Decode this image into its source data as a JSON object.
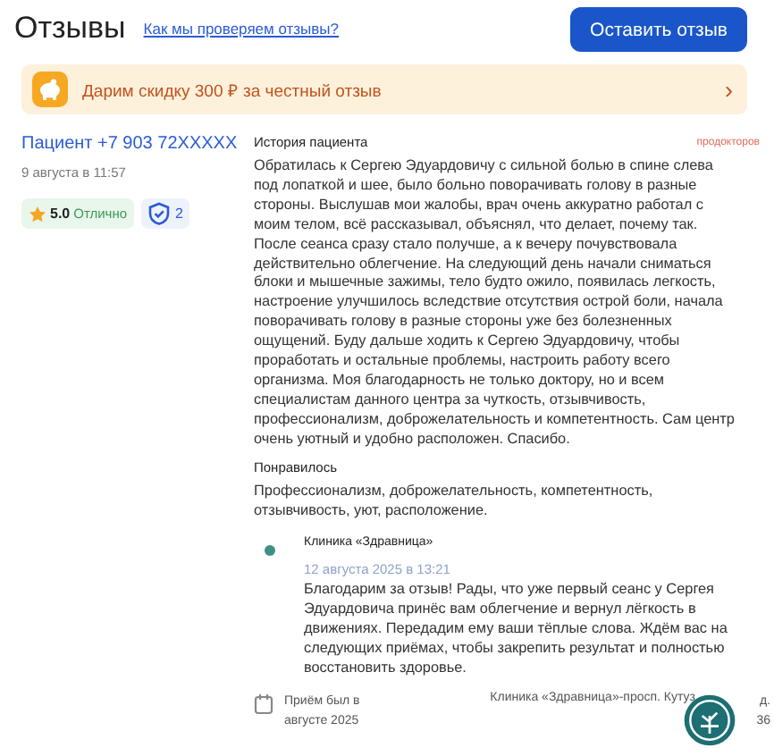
{
  "header": {
    "title": "Отзывы",
    "link": "Как мы проверяем отзывы?",
    "button": "Оставить отзыв"
  },
  "promo": {
    "text": "Дарим скидку 300 ₽ за честный отзыв",
    "arrow": "›"
  },
  "review": {
    "author": "Пациент +7 903 72XXXXX",
    "date": "9 августа в 11:57",
    "rating": "5.0",
    "rating_label": "Отлично",
    "verified_count": "2",
    "history_label": "История пациента",
    "source": "продокторов",
    "text": "Обратилась к Сергею Эдуардовичу с сильной болью в спине слева под лопаткой и шее, было больно поворачивать голову в разные стороны. Выслушав мои жалобы, врач очень аккуратно работал с моим телом, всё рассказывал, объяснял, что делает, почему так. После сеанса сразу стало получше, а к вечеру почувствовала действительно облегчение. На следующий день начали сниматься блоки и мышечные зажимы, тело будто ожило, появилась легкость, настроение улучшилось вследствие отсутствия острой боли, начала поворачивать голову в разные стороны уже без болезненных ощущений. Буду дальше ходить к Сергею Эдуардовичу, чтобы проработать и остальные проблемы, настроить работу всего организма. Моя благодарность не только доктору, но и всем специалистам данного центра за чуткость, отзывчивость, профессионализм, доброжелательность и компетентность. Сам центр очень уютный и удобно расположен. Спасибо.",
    "liked_label": "Понравилось",
    "liked": "Профессионализм, доброжелательность, компетентность, отзывчивость, уют, расположение.",
    "reply": {
      "author": "Клиника «Здравница»",
      "date": "12 августа 2025 в 13:21",
      "text": "Благодарим за отзыв! Рады, что уже первый сеанс у Сергея Эдуардовича принёс вам облегчение и вернул лёгкость в движениях. Передадим ему ваши тёплые слова. Ждём вас на следующих приёмах, чтобы закрепить результат и полностью восстановить здоровье."
    },
    "visit": "Приём был в августе 2025",
    "address": "Клиника «Здравница»-просп. Кутуз",
    "address_end": "д. 36"
  }
}
